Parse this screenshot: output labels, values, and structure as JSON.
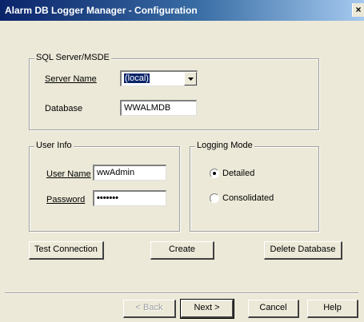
{
  "window": {
    "title": "Alarm DB Logger Manager - Configuration",
    "close_symbol": "×"
  },
  "sql_group": {
    "legend": "SQL Server/MSDE",
    "server_name_label": "Server Name",
    "server_name_value": "(local)",
    "database_label": "Database",
    "database_value": "WWALMDB"
  },
  "user_group": {
    "legend": "User Info",
    "user_name_label": "User Name",
    "user_name_value": "wwAdmin",
    "password_label": "Password",
    "password_value": "•••••••"
  },
  "logging_group": {
    "legend": "Logging Mode",
    "options": [
      {
        "label": "Detailed",
        "selected": true
      },
      {
        "label": "Consolidated",
        "selected": false
      }
    ]
  },
  "actions": {
    "test_connection": "Test Connection",
    "create": "Create",
    "delete_database": "Delete Database"
  },
  "nav": {
    "back": "< Back",
    "next": "Next >",
    "cancel": "Cancel",
    "help": "Help"
  }
}
